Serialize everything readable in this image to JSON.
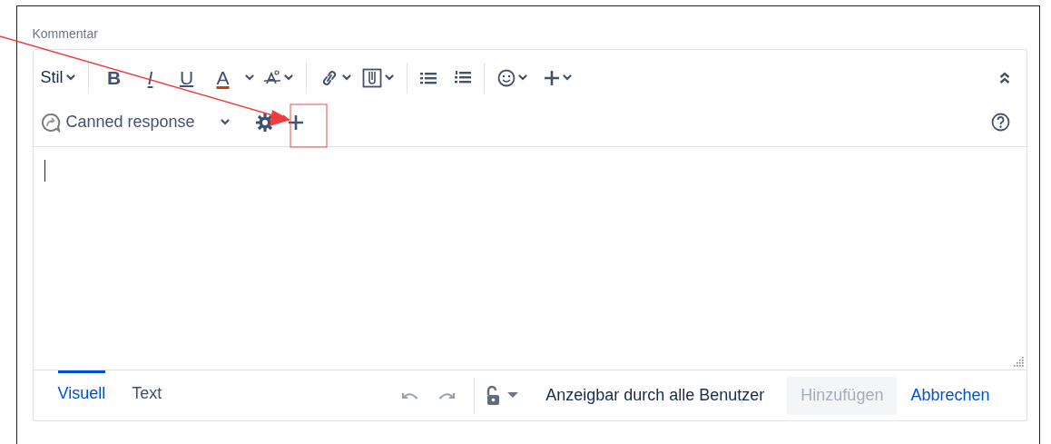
{
  "label": "Kommentar",
  "toolbar": {
    "style_menu": "Stil",
    "format_buttons": [
      {
        "kind": "bold",
        "label": "B"
      },
      {
        "kind": "italic",
        "label": "I"
      },
      {
        "kind": "underline",
        "label": "U"
      },
      {
        "kind": "color",
        "label": "A"
      }
    ]
  },
  "canned_response": {
    "label": "Canned response"
  },
  "tabs": [
    {
      "label": "Visuell",
      "selected": true
    },
    {
      "label": "Text",
      "selected": false
    }
  ],
  "visibility": "Anzeigbar durch alle Benutzer",
  "buttons": [
    {
      "kind": "primary",
      "label": "Hinzufügen",
      "disabled": true
    },
    {
      "kind": "link",
      "label": "Abbrechen",
      "disabled": false
    }
  ]
}
